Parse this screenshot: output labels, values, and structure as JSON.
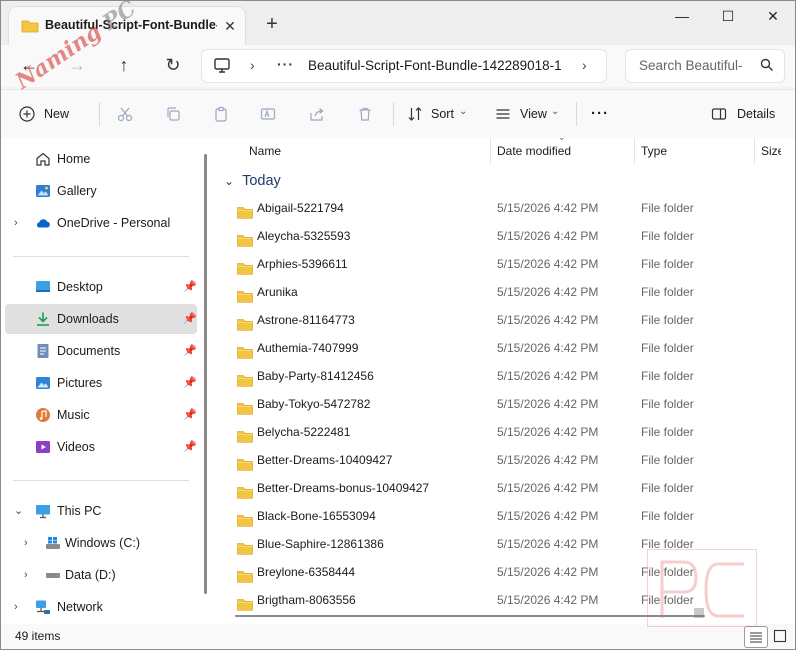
{
  "window": {
    "tab_title": "Beautiful-Script-Font-Bundle-",
    "tab_close": "✕",
    "new_tab": "+",
    "minimize": "—",
    "maximize": "☐",
    "close": "✕"
  },
  "navbar": {
    "back": "←",
    "forward": "→",
    "up": "↑",
    "refresh": "↻",
    "chevron": "›",
    "ellipsis": "···",
    "path": "Beautiful-Script-Font-Bundle-142289018-1",
    "search_placeholder": "Search Beautiful-"
  },
  "toolbar": {
    "new_label": "New",
    "sort_label": "Sort",
    "view_label": "View",
    "more_label": "···",
    "details_label": "Details",
    "caret": "⌄"
  },
  "sidebar": {
    "quick": [
      {
        "label": "Home"
      },
      {
        "label": "Gallery"
      },
      {
        "label": "OneDrive - Personal",
        "expander": "›"
      }
    ],
    "pinned": [
      {
        "label": "Desktop"
      },
      {
        "label": "Downloads",
        "selected": true
      },
      {
        "label": "Documents"
      },
      {
        "label": "Pictures"
      },
      {
        "label": "Music"
      },
      {
        "label": "Videos"
      }
    ],
    "devices": [
      {
        "label": "This PC",
        "expander": "⌄"
      },
      {
        "label": "Windows (C:)",
        "expander": "›"
      },
      {
        "label": "Data (D:)",
        "expander": "›"
      },
      {
        "label": "Network",
        "expander": "›"
      }
    ]
  },
  "columns": {
    "name": "Name",
    "date_modified": "Date modified",
    "type": "Type",
    "size": "Size"
  },
  "group": {
    "label": "Today",
    "chevron": "⌄"
  },
  "files": [
    {
      "name": "Abigail-5221794",
      "date": "5/15/2026 4:42 PM",
      "type": "File folder"
    },
    {
      "name": "Aleycha-5325593",
      "date": "5/15/2026 4:42 PM",
      "type": "File folder"
    },
    {
      "name": "Arphies-5396611",
      "date": "5/15/2026 4:42 PM",
      "type": "File folder"
    },
    {
      "name": "Arunika",
      "date": "5/15/2026 4:42 PM",
      "type": "File folder"
    },
    {
      "name": "Astrone-81164773",
      "date": "5/15/2026 4:42 PM",
      "type": "File folder"
    },
    {
      "name": "Authemia-7407999",
      "date": "5/15/2026 4:42 PM",
      "type": "File folder"
    },
    {
      "name": "Baby-Party-81412456",
      "date": "5/15/2026 4:42 PM",
      "type": "File folder"
    },
    {
      "name": "Baby-Tokyo-5472782",
      "date": "5/15/2026 4:42 PM",
      "type": "File folder"
    },
    {
      "name": "Belycha-5222481",
      "date": "5/15/2026 4:42 PM",
      "type": "File folder"
    },
    {
      "name": "Better-Dreams-10409427",
      "date": "5/15/2026 4:42 PM",
      "type": "File folder"
    },
    {
      "name": "Better-Dreams-bonus-10409427",
      "date": "5/15/2026 4:42 PM",
      "type": "File folder"
    },
    {
      "name": "Black-Bone-16553094",
      "date": "5/15/2026 4:42 PM",
      "type": "File folder"
    },
    {
      "name": "Blue-Saphire-12861386",
      "date": "5/15/2026 4:42 PM",
      "type": "File folder"
    },
    {
      "name": "Breylone-6358444",
      "date": "5/15/2026 4:42 PM",
      "type": "File folder"
    },
    {
      "name": "Brigtham-8063556",
      "date": "5/15/2026 4:42 PM",
      "type": "File folder"
    }
  ],
  "status": {
    "item_count": "49 items"
  },
  "watermark": {
    "text_a": "Naming",
    "text_b": "PC"
  },
  "colors": {
    "folder": "#f4c542",
    "accent": "#0067c0",
    "group_header": "#1f3b6b"
  }
}
